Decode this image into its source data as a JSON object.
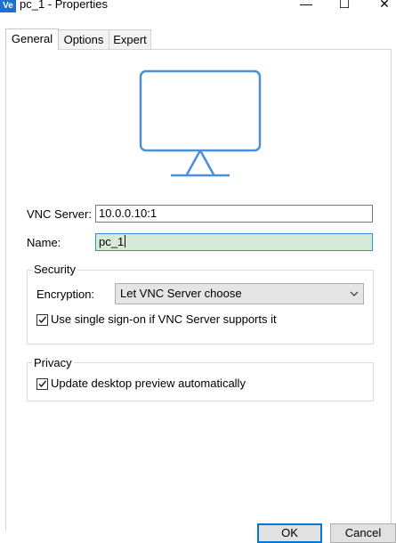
{
  "window": {
    "app_icon_text": "Ve",
    "title": "pc_1 - Properties",
    "minimize_glyph": "—",
    "maximize_glyph": "☐",
    "close_glyph": "✕"
  },
  "tabs": [
    {
      "label": "General",
      "active": true
    },
    {
      "label": "Options",
      "active": false
    },
    {
      "label": "Expert",
      "active": false
    }
  ],
  "preview": {
    "icon": "monitor-icon",
    "color": "#4a90d9"
  },
  "form": {
    "vnc_server_label": "VNC Server:",
    "vnc_server_value": "10.0.0.10:1",
    "name_label": "Name:",
    "name_value": "pc_1"
  },
  "security": {
    "title": "Security",
    "encryption_label": "Encryption:",
    "encryption_value": "Let VNC Server choose",
    "sso_label": "Use single sign-on if VNC Server supports it",
    "sso_checked": true
  },
  "privacy": {
    "title": "Privacy",
    "preview_label": "Update desktop preview automatically",
    "preview_checked": true
  },
  "buttons": {
    "ok": "OK",
    "cancel": "Cancel"
  },
  "colors": {
    "accent": "#0078d7",
    "name_field_bg": "#d6ead6",
    "icon_blue": "#4a90d9"
  }
}
